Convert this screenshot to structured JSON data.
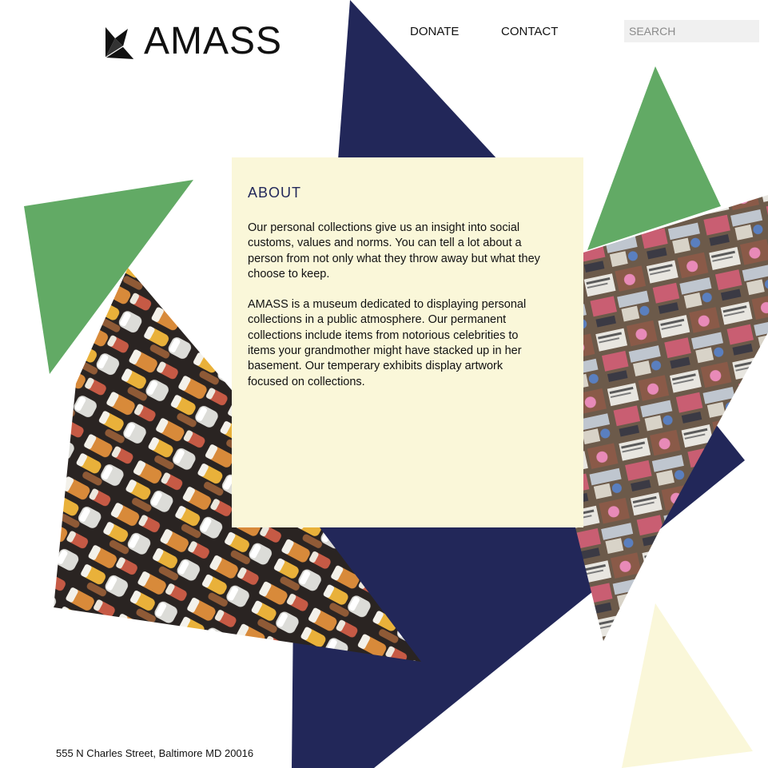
{
  "brand": {
    "name": "AMASS"
  },
  "nav": {
    "donate": "DONATE",
    "contact": "CONTACT"
  },
  "search": {
    "placeholder": "SEARCH"
  },
  "about": {
    "title": "ABOUT",
    "paragraph1": "Our personal collections give us an insight into social customs, values and norms. You can tell a lot about a person from not only what they throw away but what they choose to keep.",
    "paragraph2": "AMASS is a museum dedicated to displaying personal collections in a public atmosphere. Our permanent collections include items from notorious celebrities to items your grandmother might have stacked up in her basement. Our temperary exhibits display artwork focused on  collections."
  },
  "footer": {
    "address": "555 N Charles Street, Baltimore MD 20016"
  },
  "colors": {
    "navy": "#222759",
    "green": "#62aa65",
    "cream": "#faf7d9"
  },
  "icons": {
    "logo": "folded-paper-bird-icon"
  }
}
